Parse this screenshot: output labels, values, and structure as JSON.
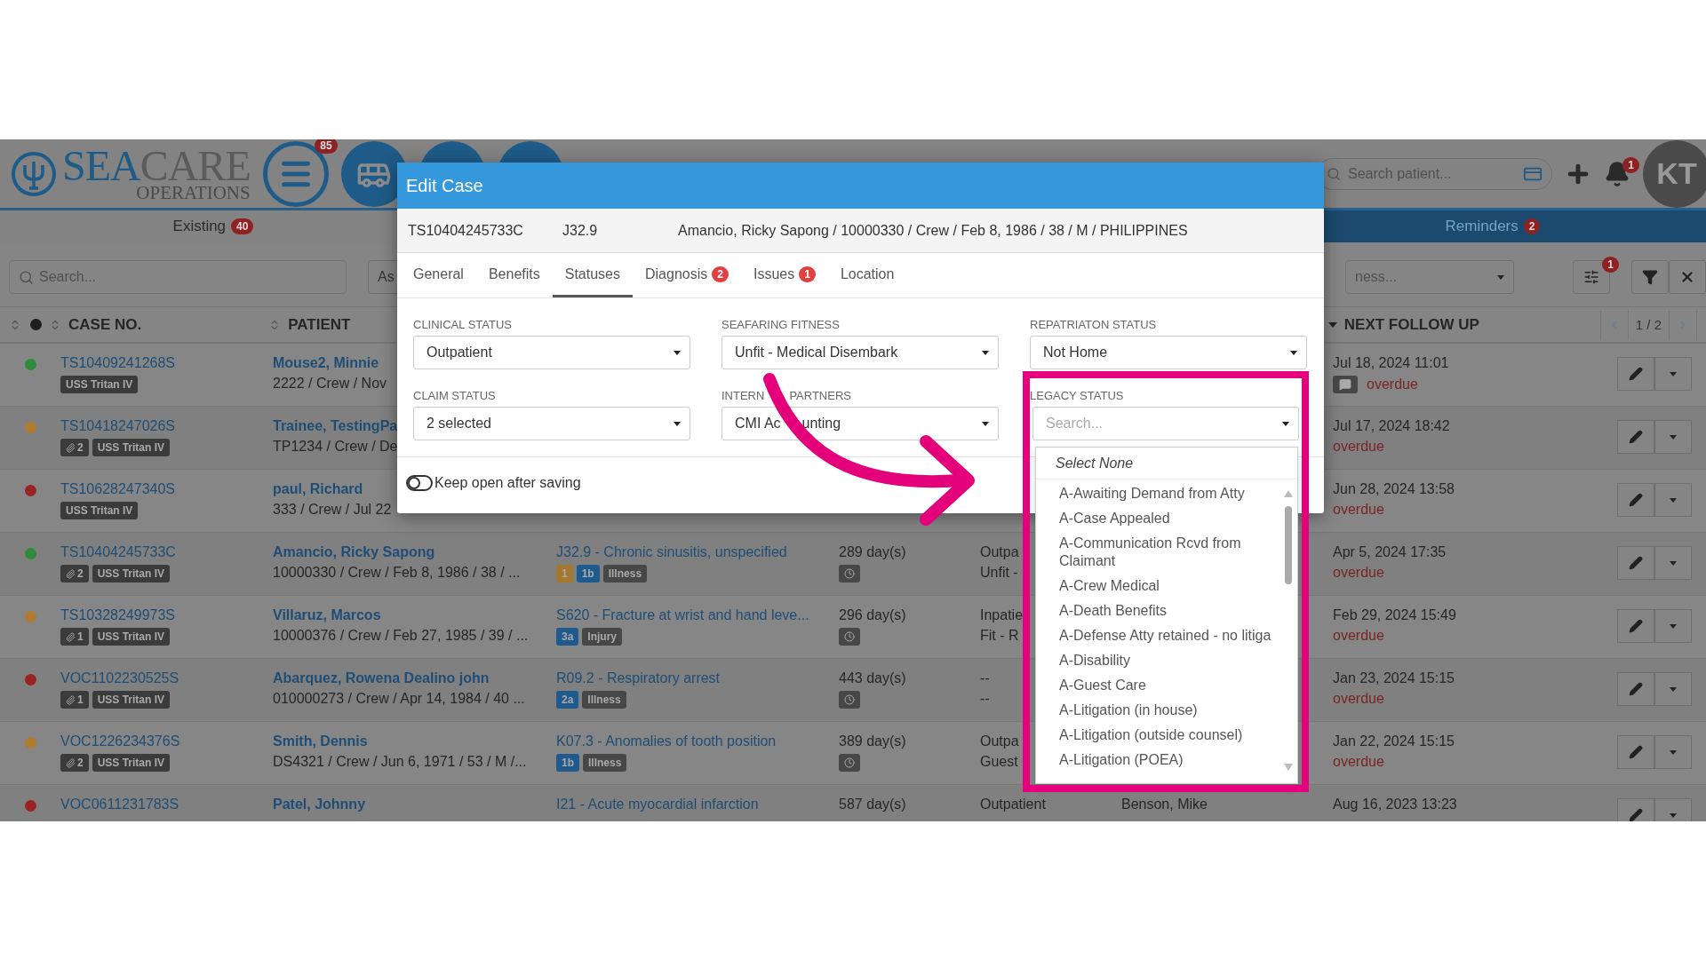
{
  "header": {
    "logo": {
      "title_parts": [
        "SEA",
        "CARE"
      ],
      "subtitle": "OPERATIONS"
    },
    "menu_badge": "85",
    "search": {
      "placeholder": "Search patient..."
    },
    "bell_badge": "1",
    "avatar": "KT"
  },
  "view_tabs": [
    {
      "label": "Existing",
      "badge": "40",
      "selected": false
    },
    {
      "label": "Reminders",
      "badge": "2",
      "selected": true
    }
  ],
  "filters": {
    "search": {
      "placeholder": "Search..."
    },
    "select_left": "As",
    "select_right": "ness...",
    "settings_badge": "1"
  },
  "table": {
    "columns": [
      "CASE NO.",
      "PATIENT",
      "NEXT FOLLOW UP"
    ],
    "pagination": "1 / 2",
    "rows": [
      {
        "color": "#2f8a3a",
        "case": "TS10409241268S",
        "tags": [
          {
            "kind": "ship",
            "text": "USS Tritan IV"
          }
        ],
        "patient": "Mouse2, Minnie",
        "patient_info": "2222 / Crew / Nov",
        "follow_up": "Jul 18, 2024 11:01",
        "comment": true,
        "note": "overdue"
      },
      {
        "color": "#b07a30",
        "case": "TS10418247026S",
        "tags": [
          {
            "kind": "attach",
            "text": "2"
          },
          {
            "kind": "ship",
            "text": "USS Tritan IV"
          }
        ],
        "patient": "Trainee, TestingPa",
        "patient_info": "TP1234 / Crew / De",
        "follow_up": "Jul 17, 2024 18:42",
        "comment": false,
        "note": "overdue"
      },
      {
        "color": "#9a2323",
        "case": "TS10628247340S",
        "tags": [
          {
            "kind": "ship",
            "text": "USS Tritan IV"
          }
        ],
        "patient": "paul, Richard",
        "patient_info": "333 / Crew / Jul 22",
        "follow_up": "Jun 28, 2024 13:58",
        "comment": false,
        "note": "overdue"
      },
      {
        "color": "#2f8a3a",
        "case": "TS10404245733C",
        "tags": [
          {
            "kind": "attach",
            "text": "2"
          },
          {
            "kind": "ship",
            "text": "USS Tritan IV"
          }
        ],
        "patient": "Amancio, Ricky Sapong",
        "patient_info": "10000330 / Crew / Feb 8, 1986 / 38 / ...",
        "diagnosis": "J32.9 - Chronic sinusitis, unspecified",
        "diag_tags": [
          {
            "kind": "priority",
            "text": "1"
          },
          {
            "kind": "class",
            "text": "1b"
          },
          {
            "kind": "type",
            "text": "Illness"
          }
        ],
        "days": "289 day(s)",
        "status": [
          "Outpa",
          "Unfit -"
        ],
        "follow_up": "Apr 5, 2024 17:35",
        "comment": false,
        "note": "overdue"
      },
      {
        "color": "#b07a30",
        "case": "TS10328249973S",
        "tags": [
          {
            "kind": "attach",
            "text": "1"
          },
          {
            "kind": "ship",
            "text": "USS Tritan IV"
          }
        ],
        "patient": "Villaruz, Marcos",
        "patient_info": "10000376 / Crew / Feb 27, 1985 / 39 / ...",
        "diagnosis": "S620 - Fracture at wrist and hand leve...",
        "diag_tags": [
          {
            "kind": "class",
            "text": "3a"
          },
          {
            "kind": "type",
            "text": "Injury"
          }
        ],
        "days": "296 day(s)",
        "status": [
          "Inpatie",
          "Fit - R"
        ],
        "follow_up": "Feb 29, 2024 15:49",
        "comment": false,
        "note": "overdue"
      },
      {
        "color": "#9a2323",
        "case": "VOC1102230525S",
        "tags": [
          {
            "kind": "attach",
            "text": "1"
          },
          {
            "kind": "ship",
            "text": "USS Tritan IV"
          }
        ],
        "patient": "Abarquez, Rowena Dealino john",
        "patient_info": "010000273 / Crew / Apr 14, 1984 / 40 ...",
        "diagnosis": "R09.2 - Respiratory arrest",
        "diag_tags": [
          {
            "kind": "class",
            "text": "2a"
          },
          {
            "kind": "type",
            "text": "Illness"
          }
        ],
        "days": "443 day(s)",
        "status": [
          "--",
          "--"
        ],
        "follow_up": "Jan 23, 2024 15:15",
        "comment": false,
        "note": "overdue"
      },
      {
        "color": "#b07a30",
        "case": "VOC1226234376S",
        "tags": [
          {
            "kind": "attach",
            "text": "2"
          },
          {
            "kind": "ship",
            "text": "USS Tritan IV"
          }
        ],
        "patient": "Smith, Dennis",
        "patient_info": "DS4321 / Crew / Jun 6, 1971 / 53 / M /...",
        "diagnosis": "K07.3 - Anomalies of tooth position",
        "diag_tags": [
          {
            "kind": "class",
            "text": "1b"
          },
          {
            "kind": "type",
            "text": "Illness"
          }
        ],
        "days": "389 day(s)",
        "status": [
          "Outpa",
          "Guest"
        ],
        "follow_up": "Jan 22, 2024 15:15",
        "comment": false,
        "note": "overdue"
      },
      {
        "color": "#9a2323",
        "case": "VOC0611231783S",
        "tags": [],
        "patient": "Patel, Johnny",
        "diagnosis": "I21 - Acute myocardial infarction",
        "diag_tags": [],
        "days": "587 day(s)",
        "status": [
          "Outpatient"
        ],
        "column_6": "Benson, Mike",
        "follow_up": "Aug 16, 2023 13:23",
        "comment": false
      }
    ]
  },
  "modal": {
    "title": "Edit Case",
    "case_no": "TS10404245733C",
    "code": "J32.9",
    "summary": "Amancio, Ricky Sapong / 10000330 / Crew / Feb 8, 1986 / 38 / M / PHILIPPINES",
    "tabs": [
      {
        "label": "General",
        "selected": false
      },
      {
        "label": "Benefits",
        "selected": false
      },
      {
        "label": "Statuses",
        "selected": true
      },
      {
        "label": "Diagnosis",
        "badge": "2",
        "selected": false
      },
      {
        "label": "Issues",
        "badge": "1",
        "selected": false
      },
      {
        "label": "Location",
        "selected": false
      }
    ],
    "fields": [
      {
        "kind": "select",
        "label": "CLINICAL STATUS",
        "value": "Outpatient"
      },
      {
        "kind": "select",
        "label": "SEAFARING FITNESS",
        "value": "Unfit - Medical Disembark"
      },
      {
        "kind": "select",
        "label": "REPATRIATON STATUS",
        "value": "Not Home"
      },
      {
        "kind": "select",
        "label": "CLAIM STATUS",
        "value": "2 selected"
      },
      {
        "kind": "select",
        "label_parts": [
          "INTERN",
          "PARTNERS"
        ],
        "value_parts": [
          "CMI Ac",
          "unting"
        ]
      },
      {
        "kind": "search",
        "label": "LEGACY STATUS",
        "placeholder": "Search..."
      }
    ],
    "keep_open": {
      "label": "Keep open after saving",
      "on": false
    },
    "dropdown": {
      "select_none": "Select None",
      "options": [
        "A-Awaiting Demand from Atty",
        "A-Case Appealed",
        "A-Communication Rcvd from Claimant",
        "A-Crew Medical",
        "A-Death Benefits",
        "A-Defense Atty retained - no litiga",
        "A-Disability",
        "A-Guest Care",
        "A-Litigation (in house)",
        "A-Litigation (outside counsel)",
        "A-Litigation (POEA)"
      ]
    }
  }
}
